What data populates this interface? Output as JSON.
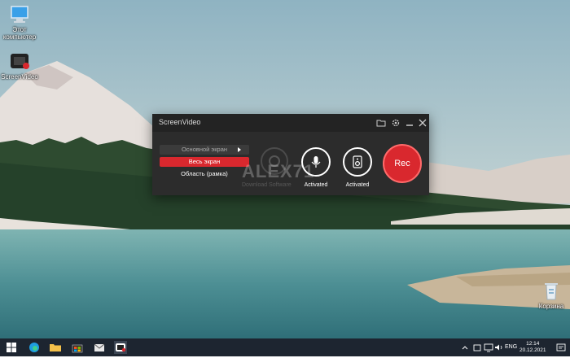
{
  "desktop": {
    "icons": [
      {
        "label": "Этот компьютер",
        "icon": "computer-icon"
      },
      {
        "label": "ScreenVideo",
        "icon": "screenvideo-app-icon"
      },
      {
        "label": "Корзина",
        "icon": "recycle-bin-icon"
      }
    ]
  },
  "app": {
    "title": "ScreenVideo",
    "titlebar_icons": [
      "folder-icon",
      "gear-icon",
      "minimize-icon",
      "close-icon"
    ],
    "modes": [
      "Основной экран",
      "Весь экран",
      "Область (рамка)"
    ],
    "selected_mode": "Весь экран",
    "watermark": "ALEX71",
    "watermark_sub": "Download Software",
    "mic_label": "Activated",
    "speaker_label": "Activated",
    "rec_label": "Rec",
    "accent": "#d9282e"
  },
  "taskbar": {
    "lang": "ENG",
    "time": "12:14",
    "date": "20.12.2021"
  }
}
